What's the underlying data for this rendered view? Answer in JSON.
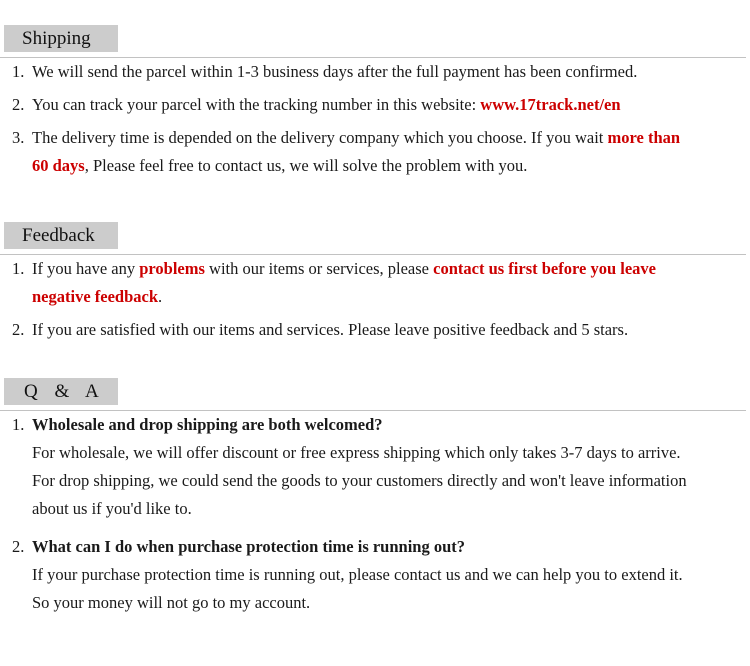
{
  "sections": [
    {
      "id": "shipping",
      "title": "Shipping",
      "items": [
        {
          "num": "1.",
          "lines": [
            [
              {
                "t": "We will send the parcel within 1-3 business days after the full payment has been confirmed.",
                "style": "normal"
              }
            ]
          ]
        },
        {
          "num": "2.",
          "lines": [
            [
              {
                "t": "You can track your parcel with the tracking number in this website: ",
                "style": "normal"
              },
              {
                "t": "www.17track.net/en",
                "style": "red"
              }
            ]
          ]
        },
        {
          "num": "3.",
          "lines": [
            [
              {
                "t": "The delivery time is depended on the delivery company which you choose. If you wait ",
                "style": "normal"
              },
              {
                "t": "more than",
                "style": "red"
              }
            ],
            [
              {
                "t": "60 days",
                "style": "red"
              },
              {
                "t": ", Please feel free to contact us, we will solve the problem with you.",
                "style": "normal"
              }
            ]
          ]
        }
      ]
    },
    {
      "id": "feedback",
      "title": "Feedback",
      "items": [
        {
          "num": "1.",
          "lines": [
            [
              {
                "t": "If you have any ",
                "style": "normal"
              },
              {
                "t": "problems",
                "style": "red"
              },
              {
                "t": " with our items or services, please ",
                "style": "normal"
              },
              {
                "t": "contact us first before you leave",
                "style": "red"
              }
            ],
            [
              {
                "t": "negative feedback",
                "style": "red"
              },
              {
                "t": ".",
                "style": "normal"
              }
            ]
          ]
        },
        {
          "num": "2.",
          "lines": [
            [
              {
                "t": "If you are satisfied with our items and services. Please leave positive feedback and 5 stars.",
                "style": "normal"
              }
            ]
          ]
        }
      ]
    },
    {
      "id": "qa",
      "title": "Q & A",
      "items": [
        {
          "num": "1.",
          "lines": [
            [
              {
                "t": "Wholesale and drop shipping are both welcomed?",
                "style": "question"
              }
            ],
            [
              {
                "t": "For wholesale, we will offer discount or free express shipping which only takes 3-7 days to arrive.",
                "style": "normal"
              }
            ],
            [
              {
                "t": "For drop shipping, we could send the goods to your customers directly and won't leave information",
                "style": "normal"
              }
            ],
            [
              {
                "t": "about us if you'd like to.",
                "style": "normal"
              }
            ]
          ]
        },
        {
          "num": "2.",
          "lines": [
            [
              {
                "t": "What can I do when purchase protection time is running out?",
                "style": "question"
              }
            ],
            [
              {
                "t": "If your purchase protection time is running out, please contact us and we can help you to extend it.",
                "style": "normal"
              }
            ],
            [
              {
                "t": "So your money will not go to my account.",
                "style": "normal"
              }
            ]
          ]
        }
      ]
    }
  ],
  "colors": {
    "accent_red": "#cc0000",
    "header_background": "#cccccc",
    "rule": "#c2c2c2",
    "text": "#1a1a1a",
    "page_background": "#ffffff"
  }
}
